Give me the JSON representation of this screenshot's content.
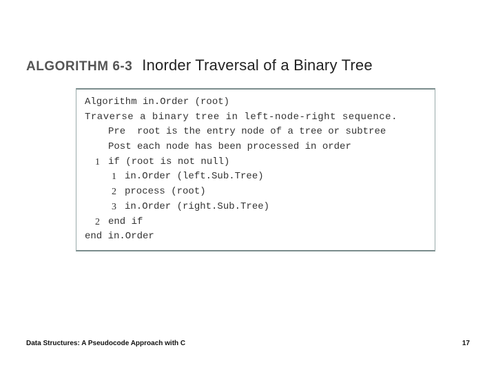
{
  "header": {
    "label": "ALGORITHM 6-3",
    "title": "Inorder Traversal of a Binary Tree"
  },
  "algorithm": {
    "name_line": "Algorithm in.Order (root)",
    "desc": "Traverse a binary tree in left-node-right sequence.",
    "pre": "Pre  root is the entry node of a tree or subtree",
    "post": "Post each node has been processed in order",
    "steps": {
      "s1": "if (root is not null)",
      "s1_1": "in.Order (left.Sub.Tree)",
      "s1_2": "process (root)",
      "s1_3": "in.Order (right.Sub.Tree)",
      "s2": "end if",
      "end": "end in.Order"
    },
    "nums": {
      "n1": "1",
      "n1_1": "1",
      "n1_2": "2",
      "n1_3": "3",
      "n2": "2"
    }
  },
  "footer": {
    "book": "Data Structures: A Pseudocode Approach with C",
    "page": "17"
  }
}
